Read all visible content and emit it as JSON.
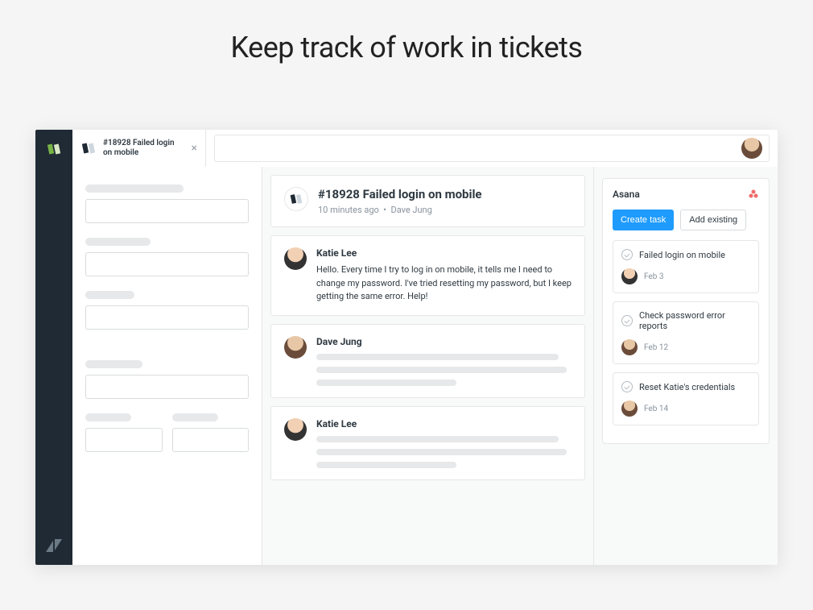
{
  "page_heading": "Keep track of work in tickets",
  "tab": {
    "title": "#18928 Failed login on mobile"
  },
  "ticket": {
    "title": "#18928 Failed login on mobile",
    "time_ago": "10 minutes ago",
    "separator": "•",
    "requester": "Dave Jung"
  },
  "messages": [
    {
      "author": "Katie Lee",
      "body": "Hello. Every time I try to log in on mobile, it tells me I need to change my password. I've tried resetting my password, but I keep getting the same error. Help!",
      "has_skeleton": false,
      "avatar_class": "avatar-a"
    },
    {
      "author": "Dave Jung",
      "body": "",
      "has_skeleton": true,
      "avatar_class": "avatar-b"
    },
    {
      "author": "Katie Lee",
      "body": "",
      "has_skeleton": true,
      "avatar_class": "avatar-a"
    }
  ],
  "asana": {
    "title": "Asana",
    "create_label": "Create task",
    "add_label": "Add existing",
    "tasks": [
      {
        "name": "Failed login on mobile",
        "date": "Feb 3",
        "avatar_class": "avatar-a"
      },
      {
        "name": "Check password error reports",
        "date": "Feb 12",
        "avatar_class": "avatar-b"
      },
      {
        "name": "Reset Katie's credentials",
        "date": "Feb 14",
        "avatar_class": "avatar-b"
      }
    ]
  }
}
